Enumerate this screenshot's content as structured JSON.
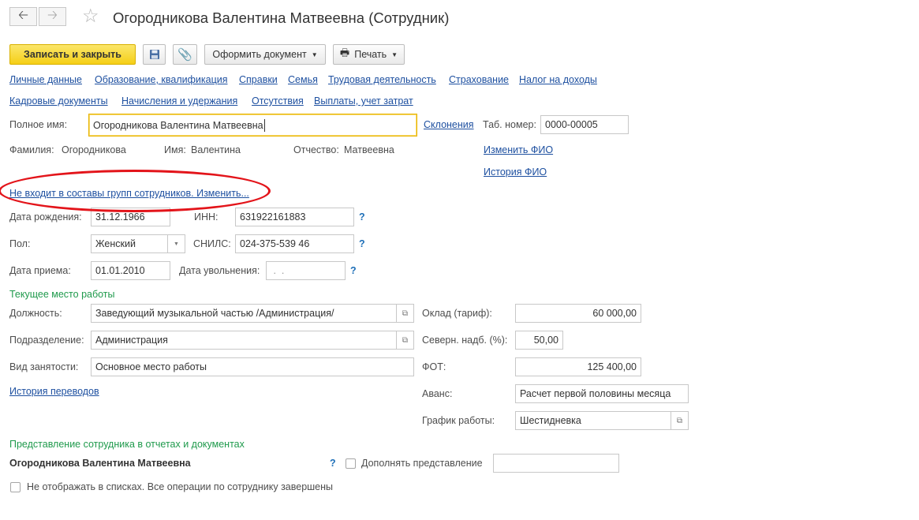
{
  "window": {
    "title": "Огородникова Валентина Матвеевна (Сотрудник)"
  },
  "nav": {
    "back_icon": "arrow-left-icon",
    "forward_icon": "arrow-right-icon",
    "favorite_icon": "star-icon"
  },
  "toolbar": {
    "save_close_label": "Записать и закрыть",
    "save_icon": "floppy-disk-icon",
    "attach_icon": "paperclip-icon",
    "create_document_label": "Оформить документ",
    "print_label": "Печать"
  },
  "tabs_row1": [
    "Личные данные",
    "Образование, квалификация",
    "Справки",
    "Семья",
    "Трудовая деятельность",
    "Страхование",
    "Налог на доходы"
  ],
  "tabs_row2": [
    "Кадровые документы",
    "Начисления и удержания",
    "Отсутствия",
    "Выплаты, учет затрат"
  ],
  "name": {
    "full_name_label": "Полное имя:",
    "full_name_value": "Огородникова Валентина Матвеевна",
    "declensions_link": "Склонения",
    "tab_number_label": "Таб. номер:",
    "tab_number_value": "0000-00005",
    "surname_label": "Фамилия:",
    "surname_value": "Огородникова",
    "first_name_label": "Имя:",
    "first_name_value": "Валентина",
    "patronymic_label": "Отчество:",
    "patronymic_value": "Матвеевна",
    "change_fio_link": "Изменить ФИО",
    "fio_history_link": "История ФИО"
  },
  "groups_link": "Не входит в составы групп сотрудников. Изменить...",
  "personal": {
    "birth_date_label": "Дата рождения:",
    "birth_date_value": "31.12.1966",
    "inn_label": "ИНН:",
    "inn_value": "631922161883",
    "gender_label": "Пол:",
    "gender_value": "Женский",
    "snils_label": "СНИЛС:",
    "snils_value": "024-375-539 46",
    "hire_date_label": "Дата приема:",
    "hire_date_value": "01.01.2010",
    "dismissal_date_label": "Дата увольнения:",
    "dismissal_date_value": " .  .",
    "help": "?"
  },
  "workplace": {
    "section_title": "Текущее место работы",
    "position_label": "Должность:",
    "position_value": "Заведующий музыкальной частью /Администрация/",
    "department_label": "Подразделение:",
    "department_value": "Администрация",
    "employment_label": "Вид занятости:",
    "employment_value": "Основное место работы",
    "transfers_link": "История переводов",
    "salary_label": "Оклад (тариф):",
    "salary_value": "60 000,00",
    "north_label": "Северн. надб. (%):",
    "north_value": "50,00",
    "fot_label": "ФОТ:",
    "fot_value": "125 400,00",
    "advance_label": "Аванс:",
    "advance_value": "Расчет первой половины месяца",
    "schedule_label": "График работы:",
    "schedule_value": "Шестидневка"
  },
  "representation": {
    "section_title": "Представление сотрудника в отчетах и документах",
    "name_value": "Огородникова Валентина Матвеевна",
    "help": "?",
    "supplement_label": "Дополнять представление",
    "supplement_value": ""
  },
  "hide_in_lists_label": "Не отображать в списках. Все операции по сотруднику завершены",
  "colors": {
    "accent_yellow": "#f5cf17",
    "link_blue": "#1e50a0",
    "section_green": "#1f9a4c",
    "annotation_red": "#e3141a"
  }
}
